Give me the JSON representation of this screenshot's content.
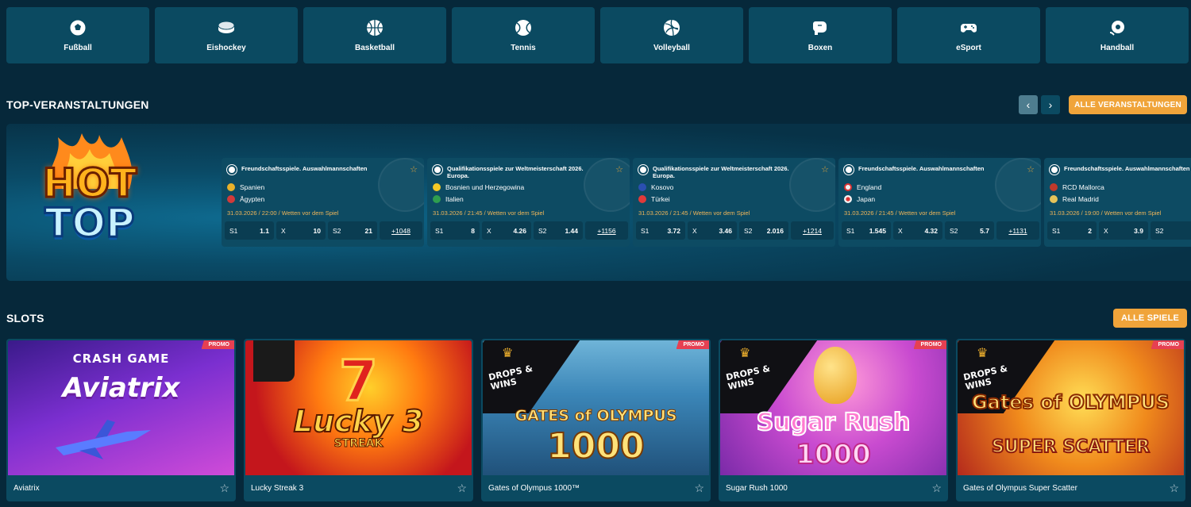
{
  "sports": [
    {
      "label": "Fußball",
      "icon": "soccer-ball-icon"
    },
    {
      "label": "Eishockey",
      "icon": "hockey-puck-icon"
    },
    {
      "label": "Basketball",
      "icon": "basketball-icon"
    },
    {
      "label": "Tennis",
      "icon": "tennis-ball-icon"
    },
    {
      "label": "Volleyball",
      "icon": "volleyball-icon"
    },
    {
      "label": "Boxen",
      "icon": "boxing-glove-icon"
    },
    {
      "label": "eSport",
      "icon": "gamepad-icon"
    },
    {
      "label": "Handball",
      "icon": "handball-icon"
    }
  ],
  "top_events": {
    "title": "TOP-VERANSTALTUNGEN",
    "all_button": "ALLE VERANSTALTUNGEN",
    "prev_icon": "chevron-left-icon",
    "next_icon": "chevron-right-icon",
    "banner": {
      "line1": "HOT",
      "line2": "TOP"
    },
    "events": [
      {
        "league": "Freundschaftsspiele. Auswahlmannschaften",
        "team1": "Spanien",
        "team2": "Ägypten",
        "meta": "31.03.2026 / 22:00 / Wetten vor dem Spiel",
        "odds": [
          {
            "k": "S1",
            "v": "1.1"
          },
          {
            "k": "X",
            "v": "10"
          },
          {
            "k": "S2",
            "v": "21"
          }
        ],
        "more": "+1048",
        "flag1": "#e8b12a",
        "flag2": "#d23a3a"
      },
      {
        "league": "Qualifikationsspiele zur Weltmeisterschaft 2026. Europa.",
        "team1": "Bosnien und Herzegowina",
        "team2": "Italien",
        "meta": "31.03.2026 / 21:45 / Wetten vor dem Spiel",
        "odds": [
          {
            "k": "S1",
            "v": "8"
          },
          {
            "k": "X",
            "v": "4.26"
          },
          {
            "k": "S2",
            "v": "1.44"
          }
        ],
        "more": "+1156",
        "flag1": "#f3c825",
        "flag2": "#2e9e4f"
      },
      {
        "league": "Qualifikationsspiele zur Weltmeisterschaft 2026. Europa.",
        "team1": "Kosovo",
        "team2": "Türkei",
        "meta": "31.03.2026 / 21:45 / Wetten vor dem Spiel",
        "odds": [
          {
            "k": "S1",
            "v": "3.72"
          },
          {
            "k": "X",
            "v": "3.46"
          },
          {
            "k": "S2",
            "v": "2.016"
          }
        ],
        "more": "+1214",
        "flag1": "#2a4fb0",
        "flag2": "#e03a3a"
      },
      {
        "league": "Freundschaftsspiele. Auswahlmannschaften",
        "team1": "England",
        "team2": "Japan",
        "meta": "31.03.2026 / 21:45 / Wetten vor dem Spiel",
        "odds": [
          {
            "k": "S1",
            "v": "1.545"
          },
          {
            "k": "X",
            "v": "4.32"
          },
          {
            "k": "S2",
            "v": "5.7"
          }
        ],
        "more": "+1131",
        "flag1": "#f2f2f2",
        "flag2": "#f2f2f2"
      },
      {
        "league": "Freundschaftsspiele. Auswahlmannschaften",
        "team1": "RCD Mallorca",
        "team2": "Real Madrid",
        "meta": "31.03.2026 / 19:00 / Wetten vor dem Spiel",
        "odds": [
          {
            "k": "S1",
            "v": "2"
          },
          {
            "k": "X",
            "v": "3.9"
          },
          {
            "k": "S2",
            "v": ""
          }
        ],
        "more": "",
        "flag1": "#c0392b",
        "flag2": "#e5c35a"
      }
    ]
  },
  "slots": {
    "title": "SLOTS",
    "all_button": "ALLE SPIELE",
    "promo_label": "PROMO",
    "games": [
      {
        "name": "Aviatrix",
        "promo": true,
        "art_top": "CRASH GAME",
        "art_main": "Aviatrix"
      },
      {
        "name": "Lucky Streak 3",
        "promo": false,
        "art_top": "7",
        "art_main": "Lucky 3",
        "art_sub": "STREAK"
      },
      {
        "name": "Gates of Olympus 1000™",
        "promo": true,
        "drops": "DROPS & WINS",
        "art_top": "GATES of OLYMPUS",
        "art_main": "1000"
      },
      {
        "name": "Sugar Rush 1000",
        "promo": true,
        "drops": "DROPS & WINS",
        "art_top": "Sugar Rush",
        "art_main": "1000"
      },
      {
        "name": "Gates of Olympus Super Scatter",
        "promo": true,
        "drops": "DROPS & WINS",
        "art_top": "Gates of OLYMPUS",
        "art_main": "SUPER SCATTER"
      }
    ]
  },
  "colors": {
    "background": "#06283a",
    "tile": "#0b4a61",
    "accent": "#f0a43a",
    "promo": "#e64052",
    "meta": "#f0b65a"
  }
}
